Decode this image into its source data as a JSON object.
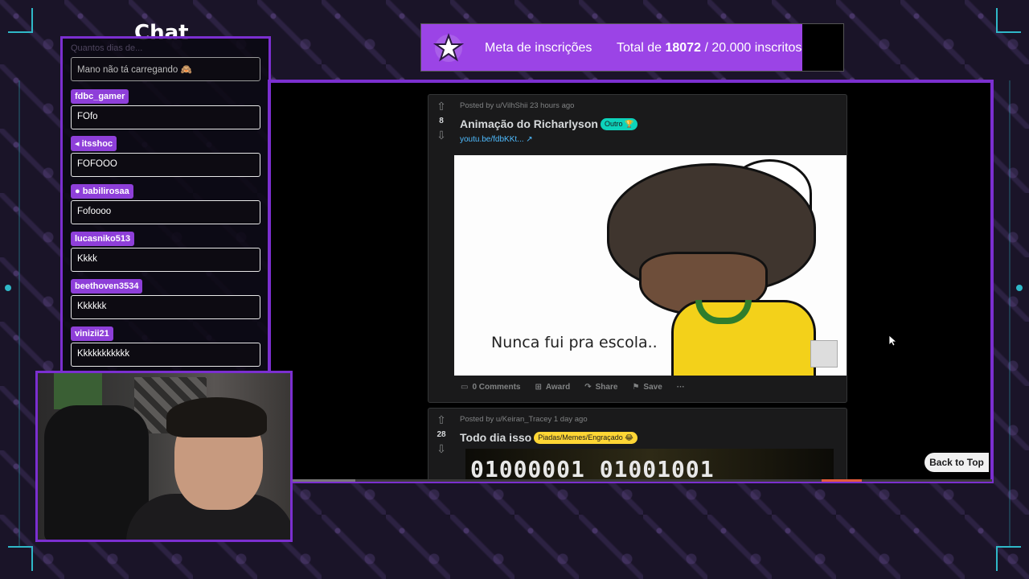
{
  "chat": {
    "title": "Chat",
    "ghost_text": "Quantos dias de...",
    "first_message": "Mano não tá carregando 🙈",
    "messages": [
      {
        "user": "fdbc_gamer",
        "text": "FOfo"
      },
      {
        "user": "itsshoc",
        "text": "FOFOOO"
      },
      {
        "user": "babilirosaa",
        "text": "Fofoooo"
      },
      {
        "user": "lucasniko513",
        "text": "Kkkk"
      },
      {
        "user": "beethoven3534",
        "text": "Kkkkkk"
      },
      {
        "user": "vinizii21",
        "text": "Kkkkkkkkkkk"
      }
    ]
  },
  "goal": {
    "label": "Meta de inscrições",
    "total_prefix": "Total de",
    "current": "18072",
    "separator": "/",
    "target": "20.000 inscritos",
    "progress": 0.9036
  },
  "posts": [
    {
      "meta": "Posted by u/VilhShii 23 hours ago",
      "votes": "8",
      "title": "Animação do Richarlyson",
      "flair": "Outro 🏆",
      "link": "youtu.be/fdbKKt... ↗",
      "media_caption": "Nunca fui pra escola..",
      "actions": {
        "comments": "0 Comments",
        "award": "Award",
        "share": "Share",
        "save": "Save",
        "more": "···"
      }
    },
    {
      "meta": "Posted by u/Keiran_Tracey 1 day ago",
      "votes": "28",
      "title": "Todo dia isso",
      "flair": "Piadas/Memes/Engraçado 😂",
      "media_text": "01000001 01001001"
    }
  ],
  "back_to_top": "Back to Top",
  "colors": {
    "accent_purple": "#7b2fd0",
    "goal_fill": "#9b44e6",
    "reddit_card": "#1a1a1b",
    "flair_teal": "#0dd3bb",
    "flair_yellow": "#ffd635"
  },
  "icons": [
    "star-badge-icon",
    "upvote-icon",
    "downvote-icon",
    "comment-icon",
    "award-icon",
    "share-icon",
    "save-icon",
    "more-icon",
    "external-link-icon",
    "cursor-icon",
    "speaker-icon"
  ]
}
